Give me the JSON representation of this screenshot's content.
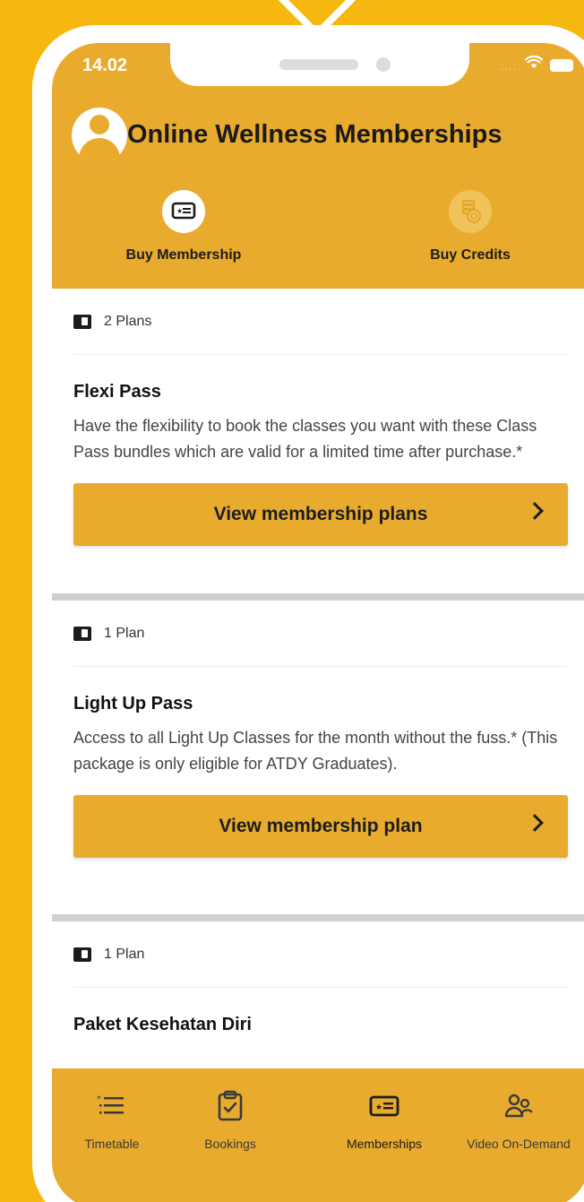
{
  "status_bar": {
    "time": "14.02"
  },
  "header": {
    "title": "Online Wellness Memberships",
    "tabs": [
      {
        "label": "Buy Membership",
        "icon": "membership-card-icon",
        "active": true
      },
      {
        "label": "Buy Credits",
        "icon": "coins-icon",
        "active": false
      }
    ]
  },
  "plans": [
    {
      "count_label": "2 Plans",
      "title": "Flexi Pass",
      "description": "Have the flexibility to book the classes you want with these Class Pass bundles which are valid for a limited time after purchase.*",
      "button_label": "View membership plans"
    },
    {
      "count_label": "1 Plan",
      "title": "Light Up Pass",
      "description": "Access to all Light Up Classes for the month without the fuss.* (This package is only eligible for ATDY Graduates).",
      "button_label": "View membership plan"
    },
    {
      "count_label": "1 Plan",
      "title": "Paket Kesehatan Diri",
      "description": "",
      "button_label": ""
    }
  ],
  "bottom_nav": [
    {
      "label": "Timetable",
      "icon": "list-icon"
    },
    {
      "label": "Bookings",
      "icon": "clipboard-check-icon"
    },
    {
      "label": "Memberships",
      "icon": "membership-card-icon",
      "active": true
    },
    {
      "label": "Video On-Demand",
      "icon": "users-icon"
    }
  ],
  "colors": {
    "background": "#f6b80e",
    "accent": "#e9ab2d",
    "frame": "#ffffff"
  }
}
